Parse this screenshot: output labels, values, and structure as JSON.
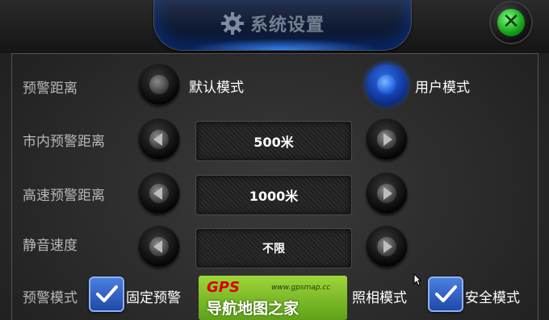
{
  "header": {
    "title": "系统设置",
    "close_icon": "close-icon"
  },
  "rows": {
    "warning_distance": {
      "label": "预警距离",
      "option_default": "默认模式",
      "option_user": "用户模式",
      "selected": "option_user"
    },
    "city_distance": {
      "label": "市内预警距离",
      "value": "500米"
    },
    "highway_distance": {
      "label": "高速预警距离",
      "value": "1000米"
    },
    "mute_speed": {
      "label": "静音速度",
      "value": "不限"
    },
    "warning_mode": {
      "label": "预警模式",
      "fixed_warning": "固定预警",
      "fixed_warning_checked": true,
      "camera_mode": "照相模式",
      "safety_mode": "安全模式",
      "safety_mode_checked": true
    }
  },
  "watermark": {
    "brand": "GPS",
    "url": "www.gpsmap.cc",
    "text": "导航地图之家"
  },
  "colors": {
    "accent_blue": "#1d5de0",
    "close_green": "#14a01a",
    "label_gray": "#b8b8b8"
  }
}
